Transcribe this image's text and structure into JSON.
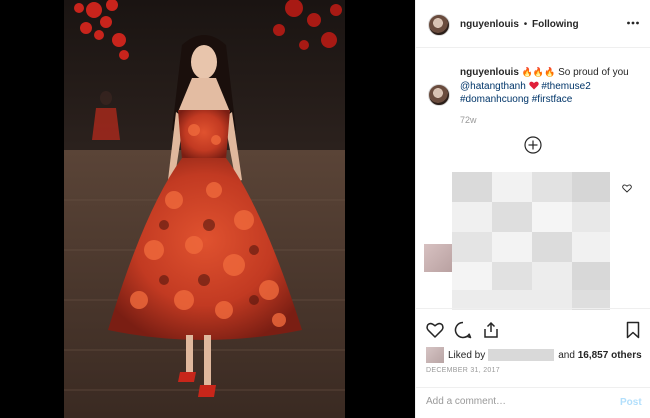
{
  "post": {
    "username": "nguyenlouis",
    "separator": "•",
    "follow_status": "Following",
    "more_icon": "ellipsis-icon"
  },
  "caption": {
    "username": "nguyenlouis",
    "emojis": "🔥🔥🔥",
    "text": "So proud of you",
    "mention": "@hatangthanh",
    "hashtag1": "#themuse2",
    "hashtag2": "#domanhcuong",
    "hashtag3": "#firstface",
    "time": "72w"
  },
  "likes": {
    "prefix": "Liked by",
    "suffix": "and",
    "count": "16,857 others"
  },
  "date": "DECEMBER 31, 2017",
  "comment": {
    "placeholder": "Add a comment…",
    "post_label": "Post"
  },
  "colors": {
    "link": "#003569",
    "post_disabled": "#b2dffc",
    "dress_red": "#d9432b"
  }
}
